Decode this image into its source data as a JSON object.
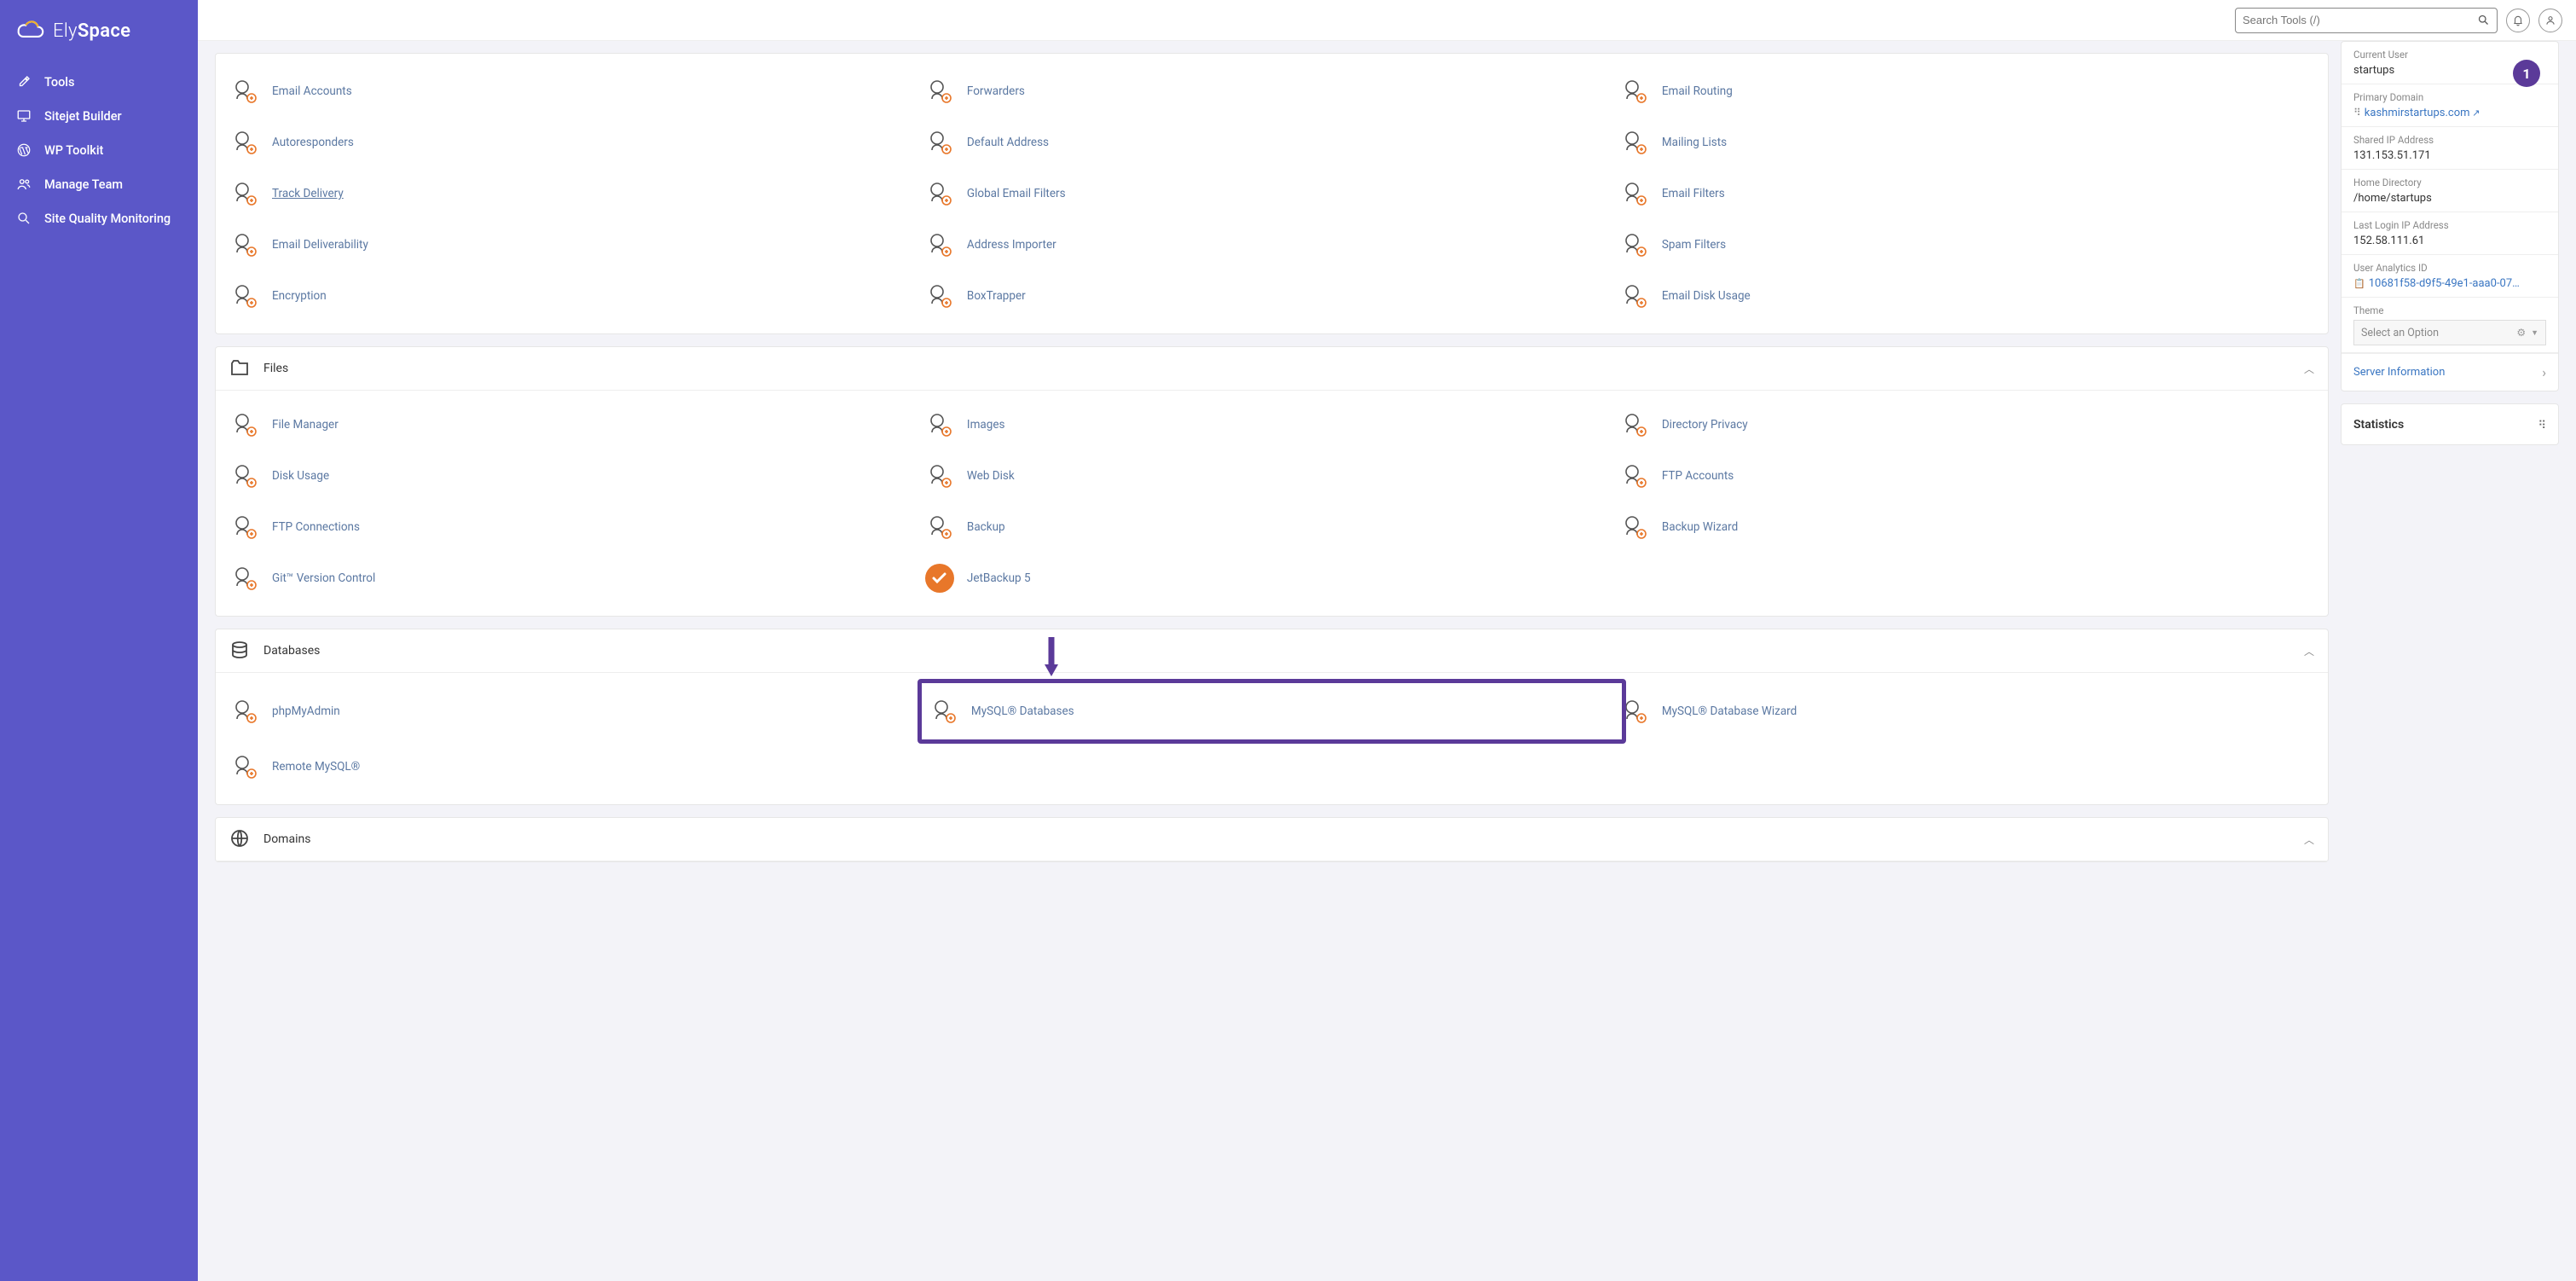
{
  "brand": "ElySpace",
  "sidebar": {
    "items": [
      {
        "label": "Tools",
        "icon": "wrench"
      },
      {
        "label": "Sitejet Builder",
        "icon": "monitor"
      },
      {
        "label": "WP Toolkit",
        "icon": "wordpress"
      },
      {
        "label": "Manage Team",
        "icon": "users"
      },
      {
        "label": "Site Quality Monitoring",
        "icon": "magnify"
      }
    ]
  },
  "header": {
    "search_placeholder": "Search Tools (/)"
  },
  "sections": [
    {
      "id": "email",
      "title": "",
      "header_visible": false,
      "apps": [
        {
          "label": "Email Accounts"
        },
        {
          "label": "Forwarders"
        },
        {
          "label": "Email Routing"
        },
        {
          "label": "Autoresponders"
        },
        {
          "label": "Default Address"
        },
        {
          "label": "Mailing Lists"
        },
        {
          "label": "Track Delivery",
          "underlined": true
        },
        {
          "label": "Global Email Filters"
        },
        {
          "label": "Email Filters"
        },
        {
          "label": "Email Deliverability"
        },
        {
          "label": "Address Importer"
        },
        {
          "label": "Spam Filters"
        },
        {
          "label": "Encryption"
        },
        {
          "label": "BoxTrapper"
        },
        {
          "label": "Email Disk Usage"
        }
      ]
    },
    {
      "id": "files",
      "title": "Files",
      "header_visible": true,
      "apps": [
        {
          "label": "File Manager"
        },
        {
          "label": "Images"
        },
        {
          "label": "Directory Privacy"
        },
        {
          "label": "Disk Usage"
        },
        {
          "label": "Web Disk"
        },
        {
          "label": "FTP Accounts"
        },
        {
          "label": "FTP Connections"
        },
        {
          "label": "Backup"
        },
        {
          "label": "Backup Wizard"
        },
        {
          "label": "Git™ Version Control"
        },
        {
          "label": "JetBackup 5",
          "solid": true
        }
      ]
    },
    {
      "id": "databases",
      "title": "Databases",
      "header_visible": true,
      "apps": [
        {
          "label": "phpMyAdmin"
        },
        {
          "label": "MySQL® Databases",
          "highlight": true
        },
        {
          "label": "MySQL® Database Wizard"
        },
        {
          "label": "Remote MySQL®"
        }
      ]
    },
    {
      "id": "domains",
      "title": "Domains",
      "header_visible": true,
      "apps": []
    }
  ],
  "info": {
    "current_user_label": "Current User",
    "current_user": "startups",
    "primary_domain_label": "Primary Domain",
    "primary_domain": "kashmirstartups.com",
    "shared_ip_label": "Shared IP Address",
    "shared_ip": "131.153.51.171",
    "home_dir_label": "Home Directory",
    "home_dir": "/home/startups",
    "last_login_label": "Last Login IP Address",
    "last_login": "152.58.111.61",
    "analytics_label": "User Analytics ID",
    "analytics": "10681f58-d9f5-49e1-aaa0-07…",
    "theme_label": "Theme",
    "theme_placeholder": "Select an Option",
    "server_info": "Server Information"
  },
  "stats_title": "Statistics",
  "step_badge": "1"
}
